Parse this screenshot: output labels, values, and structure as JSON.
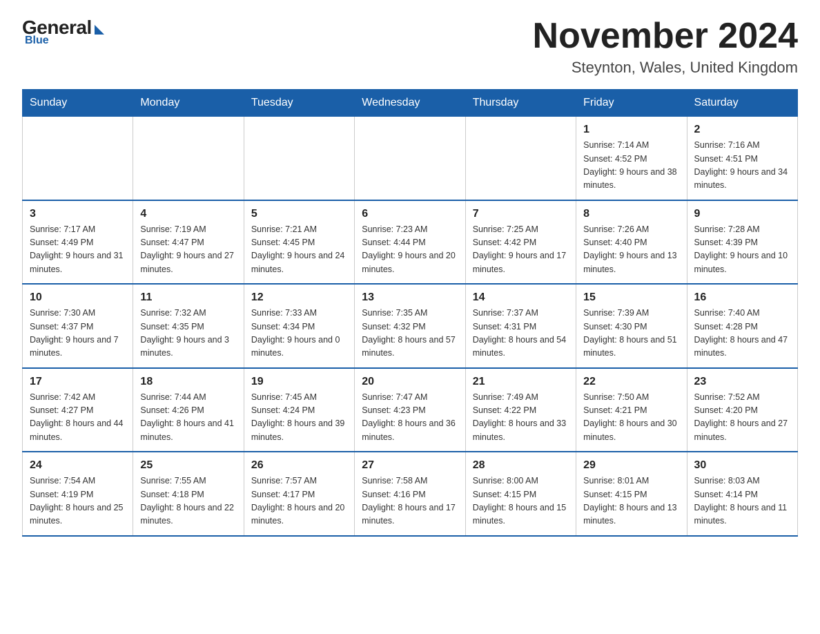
{
  "header": {
    "logo_general": "General",
    "logo_blue": "Blue",
    "month_title": "November 2024",
    "location": "Steynton, Wales, United Kingdom"
  },
  "days_of_week": [
    "Sunday",
    "Monday",
    "Tuesday",
    "Wednesday",
    "Thursday",
    "Friday",
    "Saturday"
  ],
  "weeks": [
    [
      {
        "day": "",
        "info": ""
      },
      {
        "day": "",
        "info": ""
      },
      {
        "day": "",
        "info": ""
      },
      {
        "day": "",
        "info": ""
      },
      {
        "day": "",
        "info": ""
      },
      {
        "day": "1",
        "info": "Sunrise: 7:14 AM\nSunset: 4:52 PM\nDaylight: 9 hours and 38 minutes."
      },
      {
        "day": "2",
        "info": "Sunrise: 7:16 AM\nSunset: 4:51 PM\nDaylight: 9 hours and 34 minutes."
      }
    ],
    [
      {
        "day": "3",
        "info": "Sunrise: 7:17 AM\nSunset: 4:49 PM\nDaylight: 9 hours and 31 minutes."
      },
      {
        "day": "4",
        "info": "Sunrise: 7:19 AM\nSunset: 4:47 PM\nDaylight: 9 hours and 27 minutes."
      },
      {
        "day": "5",
        "info": "Sunrise: 7:21 AM\nSunset: 4:45 PM\nDaylight: 9 hours and 24 minutes."
      },
      {
        "day": "6",
        "info": "Sunrise: 7:23 AM\nSunset: 4:44 PM\nDaylight: 9 hours and 20 minutes."
      },
      {
        "day": "7",
        "info": "Sunrise: 7:25 AM\nSunset: 4:42 PM\nDaylight: 9 hours and 17 minutes."
      },
      {
        "day": "8",
        "info": "Sunrise: 7:26 AM\nSunset: 4:40 PM\nDaylight: 9 hours and 13 minutes."
      },
      {
        "day": "9",
        "info": "Sunrise: 7:28 AM\nSunset: 4:39 PM\nDaylight: 9 hours and 10 minutes."
      }
    ],
    [
      {
        "day": "10",
        "info": "Sunrise: 7:30 AM\nSunset: 4:37 PM\nDaylight: 9 hours and 7 minutes."
      },
      {
        "day": "11",
        "info": "Sunrise: 7:32 AM\nSunset: 4:35 PM\nDaylight: 9 hours and 3 minutes."
      },
      {
        "day": "12",
        "info": "Sunrise: 7:33 AM\nSunset: 4:34 PM\nDaylight: 9 hours and 0 minutes."
      },
      {
        "day": "13",
        "info": "Sunrise: 7:35 AM\nSunset: 4:32 PM\nDaylight: 8 hours and 57 minutes."
      },
      {
        "day": "14",
        "info": "Sunrise: 7:37 AM\nSunset: 4:31 PM\nDaylight: 8 hours and 54 minutes."
      },
      {
        "day": "15",
        "info": "Sunrise: 7:39 AM\nSunset: 4:30 PM\nDaylight: 8 hours and 51 minutes."
      },
      {
        "day": "16",
        "info": "Sunrise: 7:40 AM\nSunset: 4:28 PM\nDaylight: 8 hours and 47 minutes."
      }
    ],
    [
      {
        "day": "17",
        "info": "Sunrise: 7:42 AM\nSunset: 4:27 PM\nDaylight: 8 hours and 44 minutes."
      },
      {
        "day": "18",
        "info": "Sunrise: 7:44 AM\nSunset: 4:26 PM\nDaylight: 8 hours and 41 minutes."
      },
      {
        "day": "19",
        "info": "Sunrise: 7:45 AM\nSunset: 4:24 PM\nDaylight: 8 hours and 39 minutes."
      },
      {
        "day": "20",
        "info": "Sunrise: 7:47 AM\nSunset: 4:23 PM\nDaylight: 8 hours and 36 minutes."
      },
      {
        "day": "21",
        "info": "Sunrise: 7:49 AM\nSunset: 4:22 PM\nDaylight: 8 hours and 33 minutes."
      },
      {
        "day": "22",
        "info": "Sunrise: 7:50 AM\nSunset: 4:21 PM\nDaylight: 8 hours and 30 minutes."
      },
      {
        "day": "23",
        "info": "Sunrise: 7:52 AM\nSunset: 4:20 PM\nDaylight: 8 hours and 27 minutes."
      }
    ],
    [
      {
        "day": "24",
        "info": "Sunrise: 7:54 AM\nSunset: 4:19 PM\nDaylight: 8 hours and 25 minutes."
      },
      {
        "day": "25",
        "info": "Sunrise: 7:55 AM\nSunset: 4:18 PM\nDaylight: 8 hours and 22 minutes."
      },
      {
        "day": "26",
        "info": "Sunrise: 7:57 AM\nSunset: 4:17 PM\nDaylight: 8 hours and 20 minutes."
      },
      {
        "day": "27",
        "info": "Sunrise: 7:58 AM\nSunset: 4:16 PM\nDaylight: 8 hours and 17 minutes."
      },
      {
        "day": "28",
        "info": "Sunrise: 8:00 AM\nSunset: 4:15 PM\nDaylight: 8 hours and 15 minutes."
      },
      {
        "day": "29",
        "info": "Sunrise: 8:01 AM\nSunset: 4:15 PM\nDaylight: 8 hours and 13 minutes."
      },
      {
        "day": "30",
        "info": "Sunrise: 8:03 AM\nSunset: 4:14 PM\nDaylight: 8 hours and 11 minutes."
      }
    ]
  ]
}
